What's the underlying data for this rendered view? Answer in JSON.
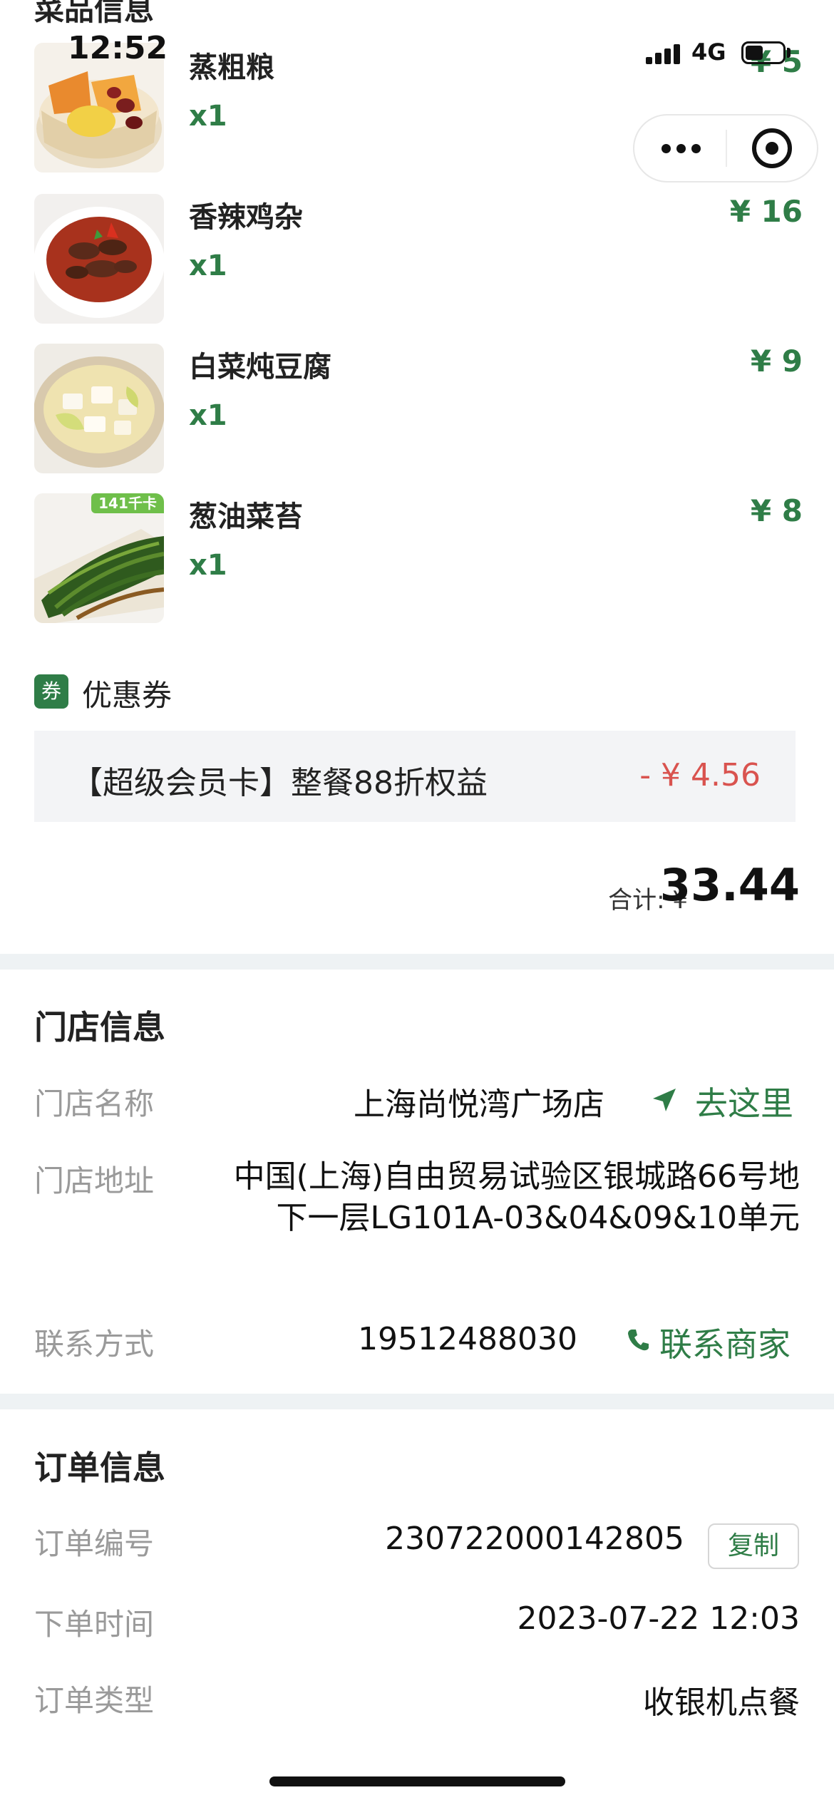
{
  "status_bar": {
    "time": "12:52",
    "network": "4G"
  },
  "partial_section_title": "菜品信息",
  "dishes": [
    {
      "name": "蒸粗粮",
      "qty": "x1",
      "price": "¥ 5",
      "image": "steamed-grains"
    },
    {
      "name": "香辣鸡杂",
      "qty": "x1",
      "price": "¥ 16",
      "image": "spicy-chicken-giblets"
    },
    {
      "name": "白菜炖豆腐",
      "qty": "x1",
      "price": "¥ 9",
      "image": "cabbage-tofu-stew"
    },
    {
      "name": "葱油菜苔",
      "qty": "x1",
      "price": "¥ 8",
      "image": "scallion-oil-greens",
      "tag": "141千卡"
    }
  ],
  "coupon": {
    "icon_text": "券",
    "title": "优惠券",
    "item": "【超级会员卡】整餐88折权益",
    "discount": "- ¥ 4.56"
  },
  "total": {
    "label": "合计: ¥",
    "value": "33.44"
  },
  "store": {
    "title": "门店信息",
    "name_label": "门店名称",
    "name_value": "上海尚悦湾广场店",
    "navigate": "去这里",
    "address_label": "门店地址",
    "address_value": "中国(上海)自由贸易试验区银城路66号地下一层LG101A-03&04&09&10单元",
    "contact_label": "联系方式",
    "contact_value": "19512488030",
    "contact_action": "联系商家"
  },
  "order": {
    "title": "订单信息",
    "number_label": "订单编号",
    "number_value": "230722000142805",
    "copy": "复制",
    "time_label": "下单时间",
    "time_value": "2023-07-22 12:03",
    "type_label": "订单类型",
    "type_value": "收银机点餐"
  },
  "colors": {
    "accent_green": "#2f7d47",
    "discount_red": "#d9534f",
    "divider": "#eef2f4"
  }
}
